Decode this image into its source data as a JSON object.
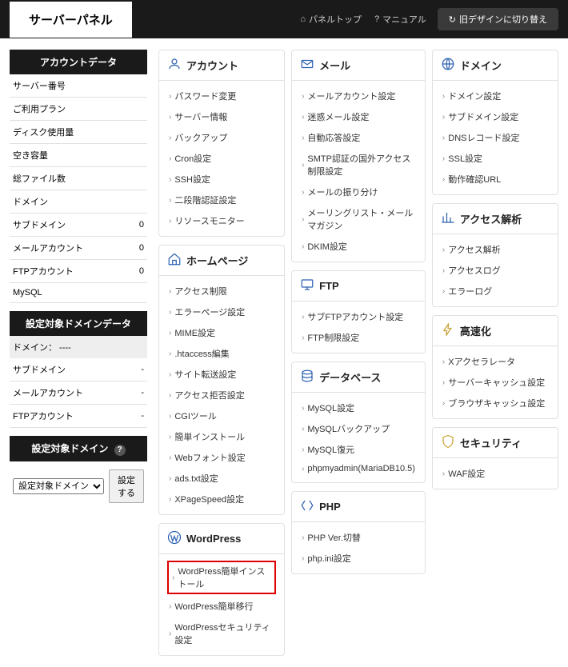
{
  "header": {
    "title": "サーバーパネル",
    "link_panel_top": "パネルトップ",
    "link_manual": "マニュアル",
    "btn_old_design": "旧デザインに切り替え"
  },
  "sidebar": {
    "account_header": "アカウントデータ",
    "rows": [
      {
        "label": "サーバー番号",
        "value": ""
      },
      {
        "label": "ご利用プラン",
        "value": ""
      },
      {
        "label": "ディスク使用量",
        "value": ""
      },
      {
        "label": "空き容量",
        "value": ""
      },
      {
        "label": "総ファイル数",
        "value": ""
      },
      {
        "label": "ドメイン",
        "value": ""
      },
      {
        "label": "サブドメイン",
        "value": "0"
      },
      {
        "label": "メールアカウント",
        "value": "0"
      },
      {
        "label": "FTPアカウント",
        "value": "0"
      },
      {
        "label": "MySQL",
        "value": ""
      }
    ],
    "domain_header": "設定対象ドメインデータ",
    "domain_label": "ドメイン： ----",
    "domain_rows": [
      {
        "label": "サブドメイン",
        "value": "-"
      },
      {
        "label": "メールアカウント",
        "value": "-"
      },
      {
        "label": "FTPアカウント",
        "value": "-"
      }
    ],
    "selector_header": "設定対象ドメイン",
    "selector_option": "設定対象ドメイン",
    "selector_btn": "設定する"
  },
  "panels": {
    "account": {
      "title": "アカウント",
      "items": [
        "パスワード変更",
        "サーバー情報",
        "バックアップ",
        "Cron設定",
        "SSH設定",
        "二段階認証設定",
        "リソースモニター"
      ]
    },
    "homepage": {
      "title": "ホームページ",
      "items": [
        "アクセス制限",
        "エラーページ設定",
        "MIME設定",
        ".htaccess編集",
        "サイト転送設定",
        "アクセス拒否設定",
        "CGIツール",
        "簡単インストール",
        "Webフォント設定",
        "ads.txt設定",
        "XPageSpeed設定"
      ]
    },
    "wordpress": {
      "title": "WordPress",
      "items": [
        "WordPress簡単インストール",
        "WordPress簡単移行",
        "WordPressセキュリティ設定"
      ],
      "highlight_index": 0
    },
    "mail": {
      "title": "メール",
      "items": [
        "メールアカウント設定",
        "迷惑メール設定",
        "自動応答設定",
        "SMTP認証の国外アクセス制限設定",
        "メールの振り分け",
        "メーリングリスト・メールマガジン",
        "DKIM設定"
      ]
    },
    "ftp": {
      "title": "FTP",
      "items": [
        "サブFTPアカウント設定",
        "FTP制限設定"
      ]
    },
    "database": {
      "title": "データベース",
      "items": [
        "MySQL設定",
        "MySQLバックアップ",
        "MySQL復元",
        "phpmyadmin(MariaDB10.5)"
      ]
    },
    "php": {
      "title": "PHP",
      "items": [
        "PHP Ver.切替",
        "php.ini設定"
      ]
    },
    "domain": {
      "title": "ドメイン",
      "items": [
        "ドメイン設定",
        "サブドメイン設定",
        "DNSレコード設定",
        "SSL設定",
        "動作確認URL"
      ]
    },
    "access": {
      "title": "アクセス解析",
      "items": [
        "アクセス解析",
        "アクセスログ",
        "エラーログ"
      ]
    },
    "speed": {
      "title": "高速化",
      "items": [
        "Xアクセラレータ",
        "サーバーキャッシュ設定",
        "ブラウザキャッシュ設定"
      ]
    },
    "security": {
      "title": "セキュリティ",
      "items": [
        "WAF設定"
      ]
    }
  }
}
